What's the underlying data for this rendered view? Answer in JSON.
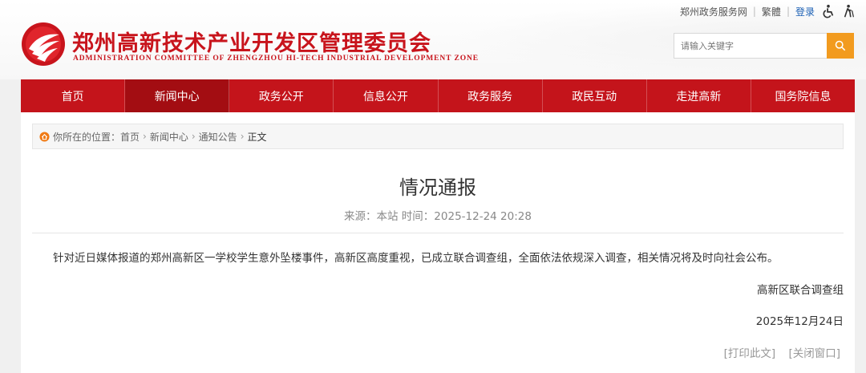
{
  "header": {
    "site_title": "郑州高新技术产业开发区管理委员会",
    "site_subtitle": "ADMINISTRATION COMMITTEE OF ZHENGZHOU HI-TECH INDUSTRIAL DEVELOPMENT ZONE",
    "top_links": {
      "gov_portal": "郑州政务服务网",
      "traditional": "繁體",
      "login": "登录"
    },
    "search": {
      "placeholder": "请输入关键字"
    }
  },
  "nav": {
    "items": [
      "首页",
      "新闻中心",
      "政务公开",
      "信息公开",
      "政务服务",
      "政民互动",
      "走进高新",
      "国务院信息"
    ],
    "active_index": 1
  },
  "breadcrumb": {
    "prefix": "你所在的位置：",
    "items": [
      "首页",
      "新闻中心",
      "通知公告"
    ],
    "current": "正文"
  },
  "article": {
    "title": "情况通报",
    "meta": "来源：本站  时间：2025-12-24 20:28",
    "body": "针对近日媒体报道的郑州高新区一学校学生意外坠楼事件，高新区高度重视，已成立联合调查组，全面依法依规深入调查，相关情况将及时向社会公布。",
    "signature": "高新区联合调查组",
    "date": "2025年12月24日"
  },
  "actions": {
    "print": "[打印此文]",
    "close": "[关闭窗口]"
  },
  "colors": {
    "brand_red": "#c4141b",
    "active_nav": "#a30d12",
    "search_orange": "#f29b1f"
  }
}
